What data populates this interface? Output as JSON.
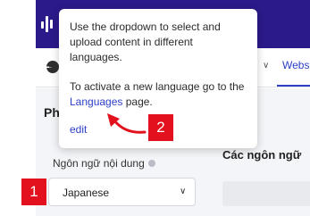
{
  "header": {
    "logo_icon": "bar-logo-icon"
  },
  "subnav": {
    "chart_icon": "pie-chart-icon",
    "chevron_icon": "chevron-down-icon",
    "link_label": "Websi"
  },
  "page": {
    "title_fragment": "Ph"
  },
  "content_language": {
    "label": "Ngôn ngữ nội dung",
    "info_icon": "info-icon",
    "selected": "Japanese",
    "chevron_icon": "chevron-down-icon"
  },
  "languages_panel": {
    "title": "Các ngôn ngữ"
  },
  "tooltip": {
    "p1": "Use the dropdown to select and upload content in different languages.",
    "p2_before": "To activate a new language go to the ",
    "p2_link": "Languages",
    "p2_after": " page.",
    "edit": "edit"
  },
  "callouts": {
    "one": "1",
    "two": "2",
    "color": "#e3101e"
  },
  "colors": {
    "header": "#2b1a8a",
    "link": "#2b3fc7"
  }
}
